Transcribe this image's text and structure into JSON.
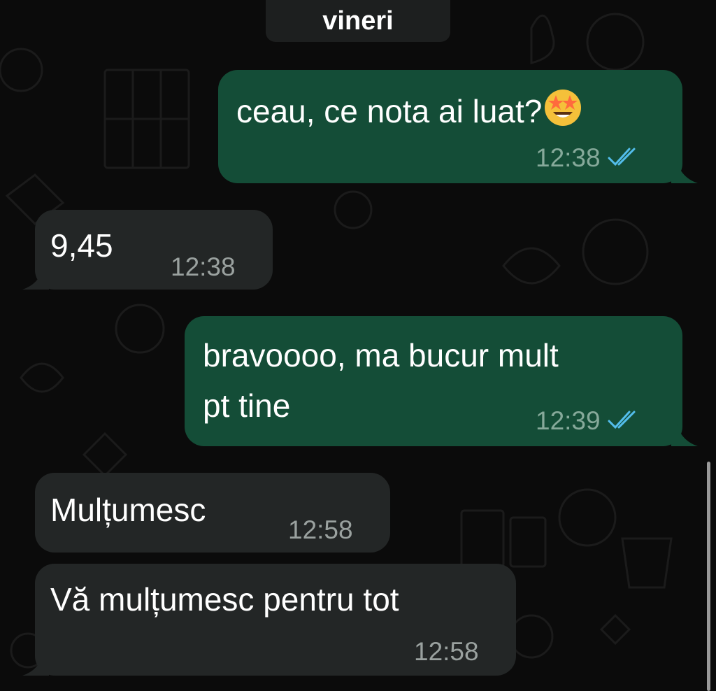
{
  "chat": {
    "date_label": "vineri",
    "colors": {
      "background": "#0b0b0b",
      "outgoing_bubble": "#144d37",
      "incoming_bubble": "#232626",
      "read_ticks": "#53bdeb"
    },
    "messages": [
      {
        "direction": "outgoing",
        "text": "ceau, ce nota ai luat?",
        "emoji": "star-struck-emoji",
        "time": "12:38",
        "status": "read"
      },
      {
        "direction": "incoming",
        "text": "9,45",
        "time": "12:38"
      },
      {
        "direction": "outgoing",
        "lines": [
          "bravoooo, ma bucur mult",
          "pt tine"
        ],
        "time": "12:39",
        "status": "read"
      },
      {
        "direction": "incoming",
        "text": "Mulțumesc",
        "time": "12:58"
      },
      {
        "direction": "incoming",
        "text": "Vă mulțumesc pentru tot",
        "time": "12:58"
      }
    ]
  }
}
